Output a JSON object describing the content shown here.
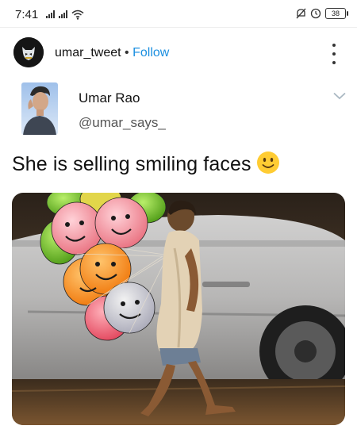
{
  "status_bar": {
    "time": "7:41",
    "battery": "38",
    "icons": [
      "signal-icon",
      "signal-icon",
      "wifi-icon",
      "mute-icon",
      "alarm-icon",
      "battery-icon"
    ]
  },
  "post_header": {
    "account": "umar_tweet",
    "separator": "•",
    "follow_label": "Follow",
    "menu_icon": "more-vertical-icon"
  },
  "tweet": {
    "display_name": "Umar Rao",
    "handle": "@umar_says_",
    "text": "She is selling smiling faces",
    "emoji": "slightly-smiling-face",
    "menu_icon": "chevron-down-icon"
  },
  "colors": {
    "follow": "#1b8fe0",
    "chevron": "#aab8c2"
  }
}
